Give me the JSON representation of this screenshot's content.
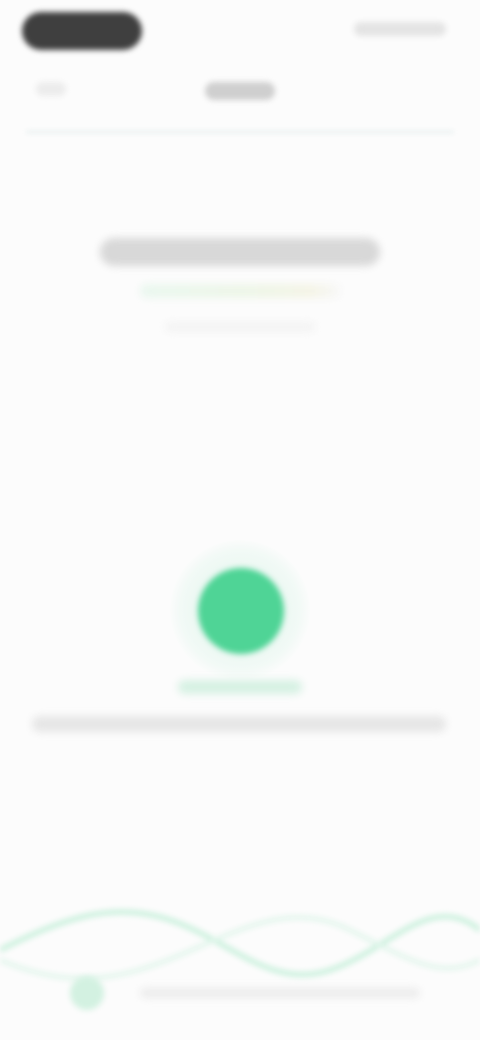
{
  "status_bar": {
    "time": "",
    "indicators": ""
  },
  "header": {
    "back_label": "",
    "title": ""
  },
  "device": {
    "name": "",
    "subtitle": "",
    "detail": ""
  },
  "connection": {
    "status_label": "",
    "description": "",
    "color": "#4fd496"
  },
  "footer": {
    "text": ""
  },
  "colors": {
    "background": "#fcfcfc",
    "accent": "#4fd496",
    "wave": "#c9f0dc"
  },
  "icons": {
    "back": "chevron-left-icon",
    "status": "connection-dot-icon"
  }
}
